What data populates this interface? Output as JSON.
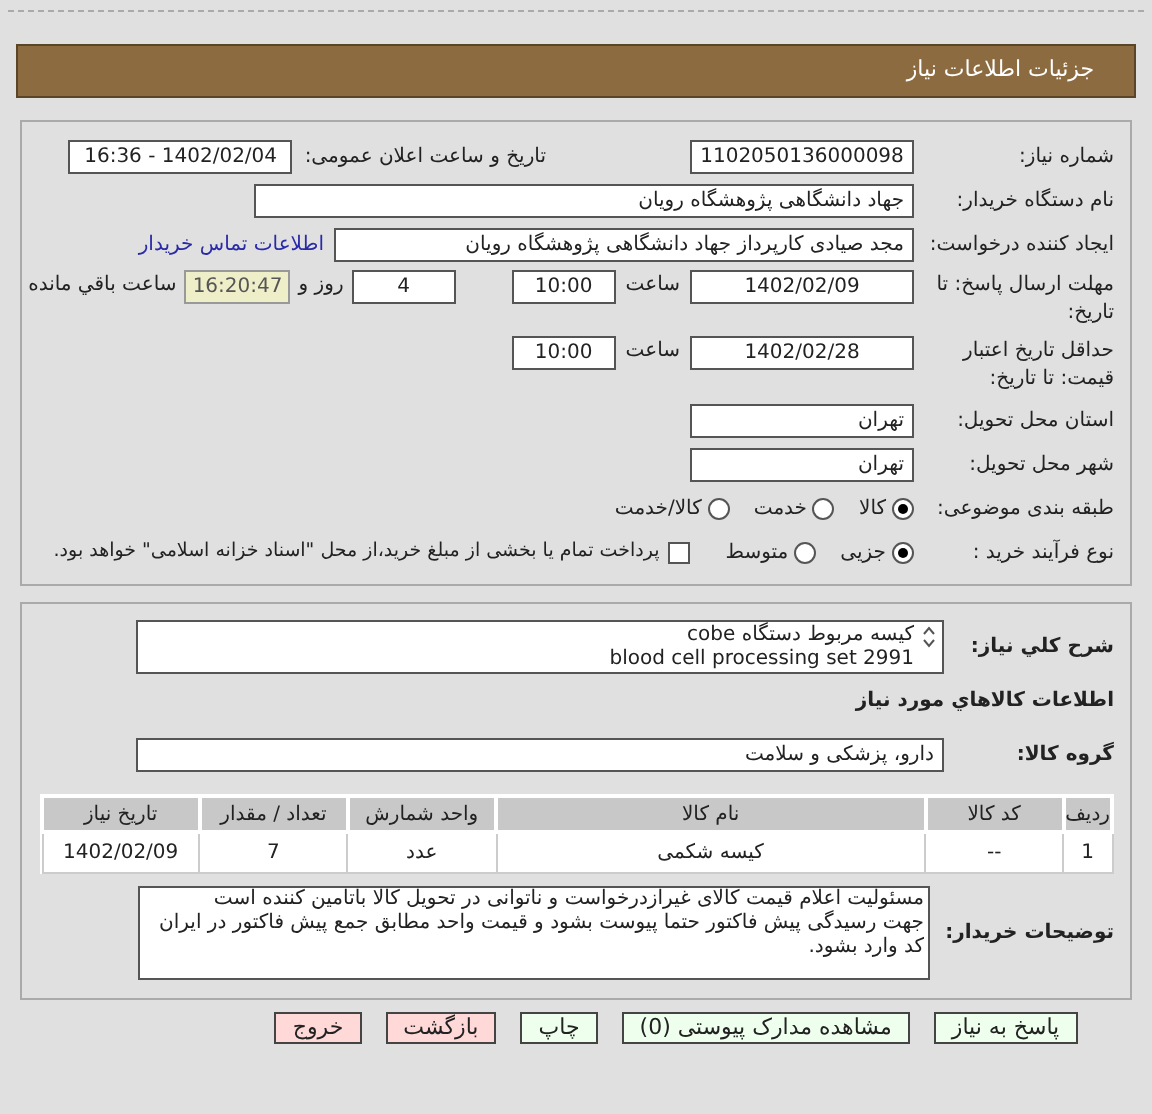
{
  "header": {
    "title": "جزئیات اطلاعات نیاز"
  },
  "need": {
    "number_label": "شماره نیاز:",
    "number": "1102050136000098",
    "announce_label": "تاریخ و ساعت اعلان عمومی:",
    "announce": "1402/02/04 - 16:36",
    "buyer_label": "نام دستگاه خریدار:",
    "buyer": "جهاد دانشگاهی پژوهشگاه رویان",
    "creator_label": "ایجاد کننده درخواست:",
    "creator": "مجد صیادی کارپرداز جهاد دانشگاهی پژوهشگاه رویان",
    "contact_link": "اطلاعات تماس خریدار",
    "deadline_label": "مهلت ارسال پاسخ: تا تاریخ:",
    "deadline_date": "1402/02/09",
    "deadline_time_label": "ساعت",
    "deadline_time": "10:00",
    "days": "4",
    "days_label": "روز و",
    "remaining": "16:20:47",
    "remaining_label": "ساعت باقي مانده",
    "validity_label": "حداقل تاریخ اعتبار قیمت: تا تاریخ:",
    "validity_date": "1402/02/28",
    "validity_time_label": "ساعت",
    "validity_time": "10:00",
    "province_label": "استان محل تحویل:",
    "province": "تهران",
    "city_label": "شهر محل تحویل:",
    "city": "تهران",
    "category_label": "طبقه بندی موضوعی:",
    "categories": [
      {
        "label": "کالا",
        "selected": true
      },
      {
        "label": "خدمت",
        "selected": false
      },
      {
        "label": "کالا/خدمت",
        "selected": false
      }
    ],
    "process_label": "نوع فرآیند خرید :",
    "processes": [
      {
        "label": "جزیی",
        "selected": true
      },
      {
        "label": "متوسط",
        "selected": false
      }
    ],
    "treasury": {
      "label": "پرداخت تمام یا بخشی از مبلغ خرید،از محل \"اسناد خزانه اسلامی\" خواهد بود.",
      "checked": false
    }
  },
  "details": {
    "description_label": "شرح کلي نياز:",
    "description_lines": [
      "کیسه مربوط دستگاه cobe",
      "blood cell processing set 2991"
    ],
    "goods_heading": "اطلاعات کالاهاي مورد نياز",
    "group_label": "گروه کالا:",
    "group": "دارو، پزشکی و سلامت",
    "table": {
      "columns": [
        "ردیف",
        "کد کالا",
        "نام کالا",
        "واحد شمارش",
        "تعداد / مقدار",
        "تاریخ نیاز"
      ],
      "rows": [
        [
          "1",
          "--",
          "کیسه شکمی",
          "عدد",
          "7",
          "1402/02/09"
        ]
      ]
    },
    "notes_label": "توضیحات خریدار:",
    "notes_lines": [
      "مسئولیت اعلام قیمت کالای غیرازدرخواست و ناتوانی در تحویل کالا باتامین کننده است",
      "جهت رسیدگی پیش فاکتور حتما پیوست بشود و قیمت واحد مطابق جمع پیش فاکتور در ایران کد وارد بشود."
    ]
  },
  "buttons": [
    {
      "label": "پاسخ به نیاز",
      "kind": "primary"
    },
    {
      "label": "مشاهده مدارک پیوستی (0)",
      "kind": "primary"
    },
    {
      "label": "چاپ",
      "kind": "primary"
    },
    {
      "label": "بازگشت",
      "kind": "danger"
    },
    {
      "label": "خروج",
      "kind": "danger"
    }
  ]
}
